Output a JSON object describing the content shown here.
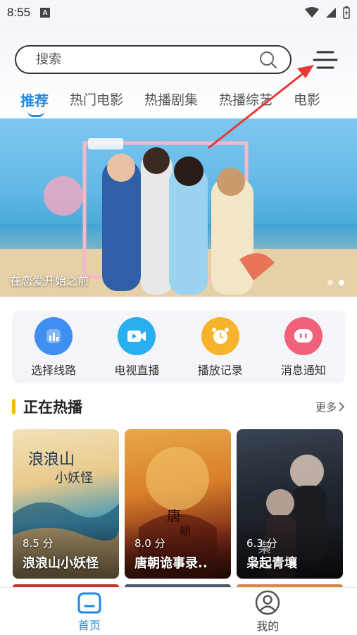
{
  "status_bar": {
    "time": "8:55",
    "notification_icon": "A"
  },
  "search": {
    "placeholder": "搜索"
  },
  "tabs": [
    {
      "label": "推荐",
      "active": true
    },
    {
      "label": "热门电影",
      "active": false
    },
    {
      "label": "热播剧集",
      "active": false
    },
    {
      "label": "热播综艺",
      "active": false
    },
    {
      "label": "电影",
      "active": false
    }
  ],
  "banner": {
    "caption": "在恋爱开始之前",
    "slide_count": 2,
    "active_slide": 2
  },
  "quick_actions": [
    {
      "label": "选择线路",
      "icon": "route-icon",
      "color": "#3f8ff0"
    },
    {
      "label": "电视直播",
      "icon": "video-camera-icon",
      "color": "#29aef0"
    },
    {
      "label": "播放记录",
      "icon": "alarm-clock-icon",
      "color": "#f7b32b"
    },
    {
      "label": "消息通知",
      "icon": "message-icon",
      "color": "#f0627a"
    }
  ],
  "section": {
    "title": "正在热播",
    "more_label": "更多"
  },
  "movies": [
    {
      "score": "8.5 分",
      "title": "浪浪山小妖怪"
    },
    {
      "score": "8.0 分",
      "title": "唐朝诡事录.."
    },
    {
      "score": "6.3 分",
      "title": "枭起青壤"
    }
  ],
  "bottom_nav": [
    {
      "label": "首页",
      "icon": "home-icon",
      "active": true
    },
    {
      "label": "我的",
      "icon": "user-profile-icon",
      "active": false
    }
  ],
  "colors": {
    "accent": "#1e88e5",
    "section_bar": "#f6b70f",
    "annotation_arrow": "#e53935"
  }
}
